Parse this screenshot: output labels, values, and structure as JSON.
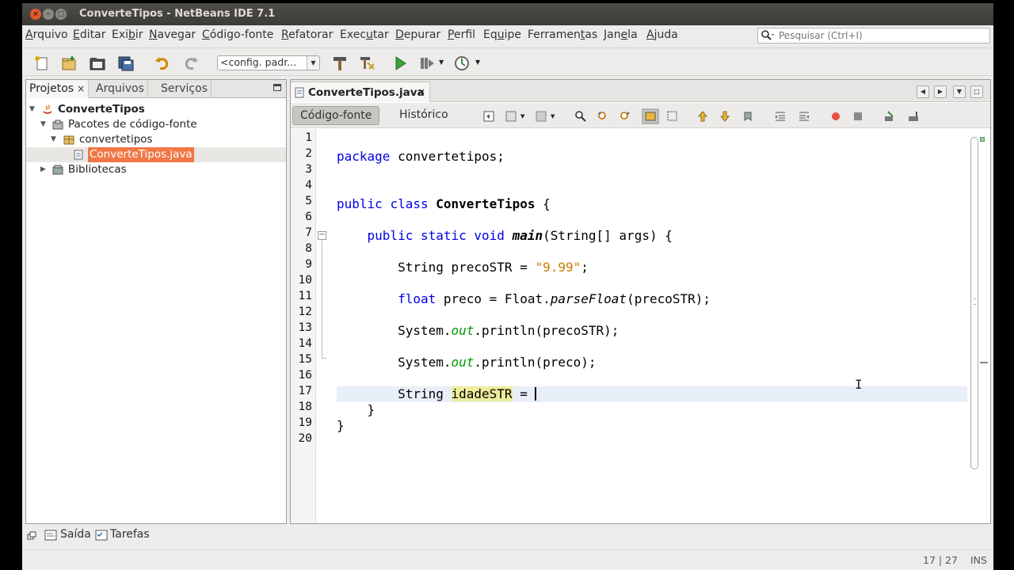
{
  "window": {
    "title": "ConverteTipos - NetBeans IDE 7.1",
    "close_glyph": "×",
    "min_glyph": "–",
    "max_glyph": "□"
  },
  "menu": {
    "items": [
      {
        "u": "A",
        "rest": "rquivo"
      },
      {
        "u": "E",
        "rest": "ditar"
      },
      {
        "pre": "Exi",
        "u": "b",
        "rest": "ir"
      },
      {
        "u": "N",
        "rest": "avegar"
      },
      {
        "u": "C",
        "rest": "ódigo-fonte"
      },
      {
        "u": "R",
        "rest": "efatorar"
      },
      {
        "pre": "Exec",
        "u": "u",
        "rest": "tar"
      },
      {
        "u": "D",
        "rest": "epurar"
      },
      {
        "u": "P",
        "rest": "erfil"
      },
      {
        "pre": "Eq",
        "u": "u",
        "rest": "ipe"
      },
      {
        "pre": "Ferramen",
        "u": "t",
        "rest": "as"
      },
      {
        "pre": "Jan",
        "u": "e",
        "rest": "la"
      },
      {
        "u": "A",
        "rest": "juda"
      }
    ]
  },
  "search": {
    "placeholder": "Pesquisar (Ctrl+I)"
  },
  "toolbar": {
    "config_value": "<config. padr...",
    "config_arrow": "▼"
  },
  "left_panel": {
    "tabs": [
      "Projetos",
      "Arquivos",
      "Serviços"
    ],
    "close_glyph": "×",
    "tree": [
      {
        "label": "ConverteTipos",
        "expanded": true
      },
      {
        "label": "Pacotes de código-fonte",
        "expanded": true
      },
      {
        "label": "convertetipos",
        "expanded": true
      },
      {
        "label": "ConverteTipos.java",
        "selected": true
      },
      {
        "label": "Bibliotecas",
        "expanded": false
      }
    ],
    "arrow_open": "▼",
    "arrow_closed": "▶"
  },
  "bottom": {
    "output_label": "Saída",
    "tasks_label": "Tarefas"
  },
  "status": {
    "position": "17 | 27",
    "mode": "INS"
  },
  "editor": {
    "tab_label": "ConverteTipos.java",
    "tab_close": "×",
    "nav": [
      "◀",
      "▶",
      "▼",
      "□"
    ],
    "mode_source": "Código-fonte",
    "mode_history": "Histórico",
    "line_numbers": [
      "1",
      "2",
      "3",
      "4",
      "5",
      "6",
      "7",
      "8",
      "9",
      "10",
      "11",
      "12",
      "13",
      "14",
      "15",
      "16",
      "17",
      "18",
      "19",
      "20"
    ],
    "fold_glyph": "−",
    "code": {
      "l2_kw": "package",
      "l2_rest": " convertetipos;",
      "l5_kw1": "public",
      "l5_kw2": "class",
      "l5_name": "ConverteTipos",
      "l5_rest": " {",
      "l7_kw": "public static void",
      "l7_name": "main",
      "l7_rest": "(String[] args) {",
      "l9_pre": "String precoSTR = ",
      "l9_str": "\"9.99\"",
      "l9_post": ";",
      "l11_kw": "float",
      "l11_mid": " preco = Float.",
      "l11_call": "parseFloat",
      "l11_post": "(precoSTR);",
      "l13_pre": "System.",
      "l13_field": "out",
      "l13_post": ".println(precoSTR);",
      "l15_pre": "System.",
      "l15_field": "out",
      "l15_post": ".println(preco);",
      "l17_pre": "String ",
      "l17_var": "idadeSTR",
      "l17_post": " = ",
      "l18": "}",
      "l19": "}"
    },
    "cursor_glyph": "I"
  }
}
